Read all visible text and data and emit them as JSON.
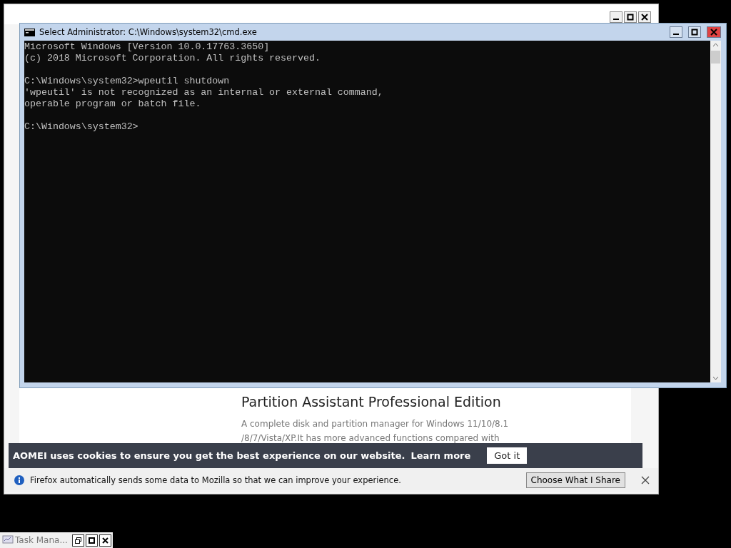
{
  "browser": {
    "heading": "Partition Assistant Professional Edition",
    "description_lines": [
      "A complete disk and partition manager for Windows 11/10/8.1",
      "/8/7/Vista/XP.It has more advanced functions compared with"
    ],
    "cookie_banner": {
      "text": "AOMEI uses cookies to ensure you get the best experience on our website.",
      "link": "Learn more",
      "button": "Got it"
    },
    "notification": {
      "text": "Firefox automatically sends some data to Mozilla so that we can improve your experience.",
      "button": "Choose What I Share"
    }
  },
  "console": {
    "title": "Select Administrator: C:\\Windows\\system32\\cmd.exe",
    "blocks": [
      [
        "Microsoft Windows [Version 10.0.17763.3650]",
        "(c) 2018 Microsoft Corporation. All rights reserved."
      ],
      [
        "C:\\Windows\\system32>wpeutil shutdown",
        "'wpeutil' is not recognized as an internal or external command,",
        "operable program or batch file."
      ],
      [
        "C:\\Windows\\system32>"
      ]
    ]
  },
  "taskbar_item": {
    "label": "Task Mana..."
  }
}
